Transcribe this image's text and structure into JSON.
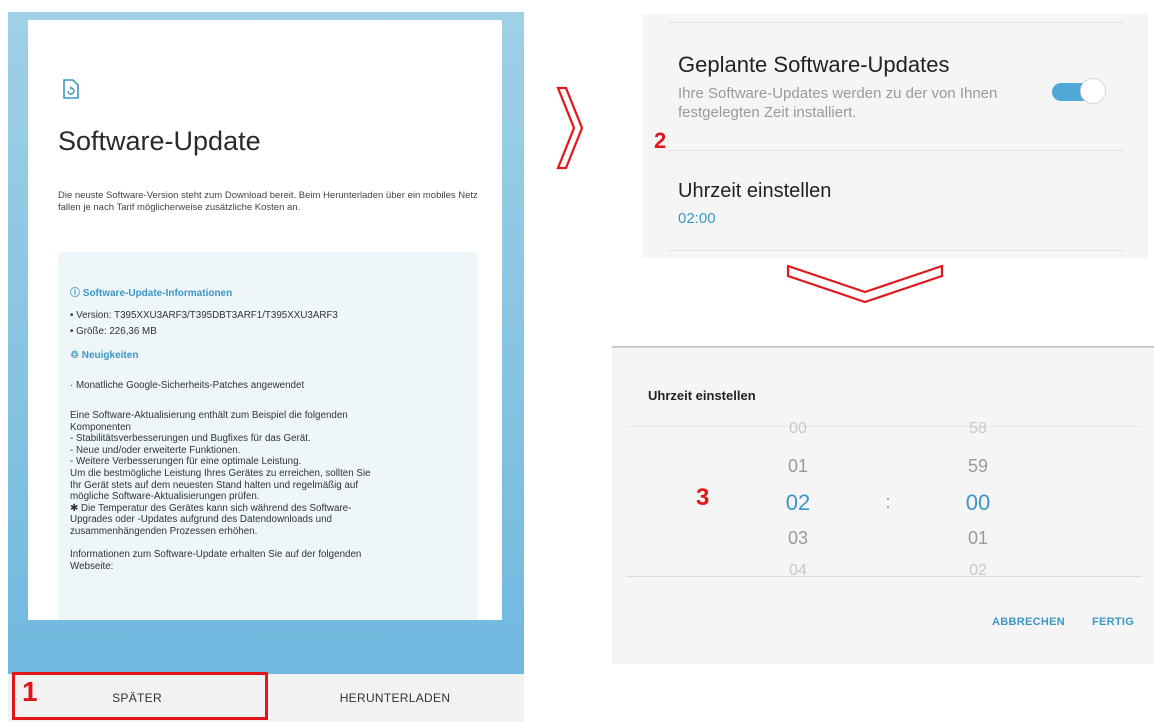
{
  "panel1": {
    "title": "Software-Update",
    "intro": "Die neuste Software-Version steht zum Download bereit. Beim Herunterladen über ein mobiles Netz fallen je nach Tarif möglicherweise zusätzliche Kosten an.",
    "info_heading": "Software-Update-Informationen",
    "version_line": "• Version: T395XXU3ARF3/T395DBT3ARF1/T395XXU3ARF3",
    "size_line": "• Größe: 226,36 MB",
    "news_heading": "Neuigkeiten",
    "news_line": "· Monatliche Google-Sicherheits-Patches angewendet",
    "body_lines": [
      "Eine Software-Aktualisierung enthält zum Beispiel die folgenden",
      "Komponenten",
      " - Stabilitätsverbesserungen und Bugfixes für das Gerät.",
      " - Neue und/oder erweiterte Funktionen.",
      " - Weitere Verbesserungen für eine optimale Leistung.",
      "Um die bestmögliche Leistung Ihres Gerätes zu erreichen, sollten Sie",
      "Ihr Gerät stets auf dem neuesten Stand halten und regelmäßig auf",
      "mögliche Software-Aktualisierungen prüfen.",
      "✱ Die Temperatur des Gerätes kann sich während des Software-",
      "Upgrades oder -Updates aufgrund des Datendownloads und",
      "zusammenhängenden Prozessen erhöhen.",
      "",
      "Informationen zum Software-Update erhalten Sie auf der folgenden",
      "Webseite:"
    ],
    "later_button": "SPÄTER",
    "download_button": "HERUNTERLADEN",
    "step": "1"
  },
  "panel2": {
    "title": "Geplante Software-Updates",
    "subtitle": "Ihre Software-Updates werden zu der von Ihnen festgelegten Zeit installiert.",
    "toggle_on": true,
    "time_label": "Uhrzeit einstellen",
    "time_value": "02:00",
    "step": "2"
  },
  "panel3": {
    "title": "Uhrzeit einstellen",
    "hours": [
      "00",
      "01",
      "02",
      "03",
      "04"
    ],
    "minutes": [
      "58",
      "59",
      "00",
      "01",
      "02"
    ],
    "separator": ":",
    "cancel": "ABBRECHEN",
    "done": "FERTIG",
    "step": "3"
  },
  "colors": {
    "accent": "#3d97c4",
    "highlight": "#e0161b",
    "phone_bg": "#7cbfe0"
  }
}
